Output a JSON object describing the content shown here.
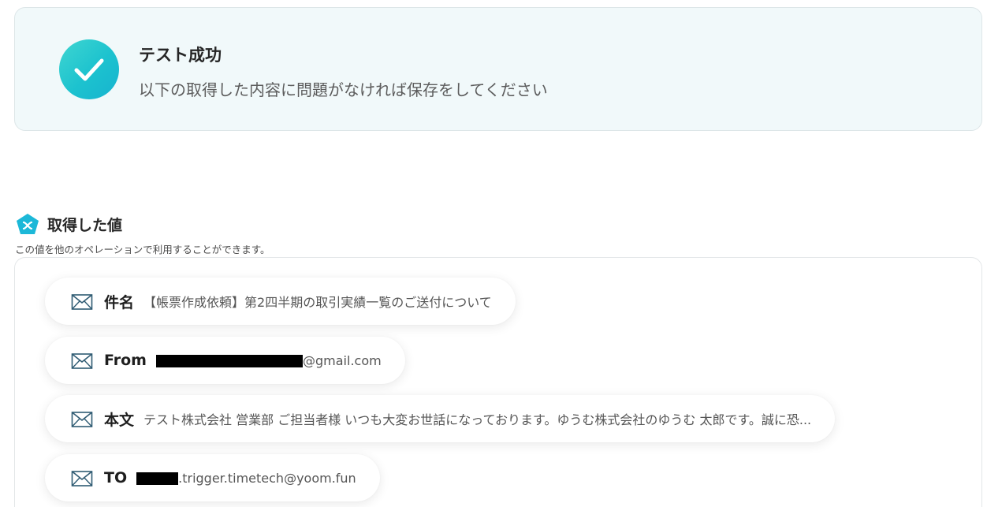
{
  "banner": {
    "title": "テスト成功",
    "subtitle": "以下の取得した内容に問題がなければ保存をしてください",
    "icon": "check-circle-icon",
    "accent": "#1cc2cf"
  },
  "section": {
    "title": "取得した値",
    "description": "この値を他のオペレーションで利用することができます。",
    "icon": "pentagon-variable-icon"
  },
  "fields": {
    "subject": {
      "key": "件名",
      "value": "【帳票作成依頼】第2四半期の取引実績一覧のご送付について"
    },
    "from": {
      "key": "From",
      "value": "@gmail.com"
    },
    "body": {
      "key": "本文",
      "value": "テスト株式会社 営業部 ご担当者様 いつも大変お世話になっております。ゆうむ株式会社のゆうむ 太郎です。誠に恐..."
    },
    "to": {
      "key": "TO",
      "value": ".trigger.timetech@yoom.fun"
    }
  }
}
